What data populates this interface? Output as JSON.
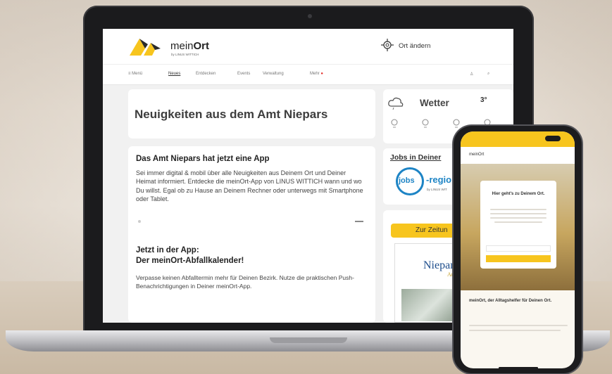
{
  "brand": {
    "name_pre": "mein",
    "name_bold": "Ort",
    "byline": "by LINUS WITTICH"
  },
  "header": {
    "location_label": "Ort ändern"
  },
  "nav": {
    "items": [
      "Menü",
      "Neues",
      "Entdecken",
      "Events",
      "Verwaltung",
      "Mehr"
    ]
  },
  "main": {
    "news_heading": "Neuigkeiten aus dem Amt Niepars",
    "app_card": {
      "title": "Das Amt Niepars hat jetzt eine App",
      "body": "Sei immer digital & mobil über alle Neuigkeiten aus Deinem Ort und Deiner Heimat informiert. Entdecke die meinOrt-App von LINUS WITTICH wann und wo Du willst. Egal ob zu Hause an Deinem Rechner oder unterwegs mit Smartphone oder Tablet."
    },
    "calendar_card": {
      "title_line1": "Jetzt in der App:",
      "title_line2": "Der meinOrt-Abfallkalender!",
      "body": "Verpasse keinen Abfalltermin mehr für Deinen Bezirk. Nutze die praktischen Push-Benachrichtigungen in Deiner meinOrt-App."
    }
  },
  "sidebar": {
    "weather_label": "Wetter",
    "weather_temp": "3°",
    "jobs_title": "Jobs in Deiner",
    "jobs_logo_prefix": "jobs",
    "jobs_logo_suffix": "-region",
    "jobs_logo_byline": "by LINUS WIT",
    "newspaper_button": "Zur Zeitun",
    "newspaper_name": "Niepar",
    "newspaper_sub": "Amt"
  },
  "phone": {
    "logo": "meinOrt",
    "card_title": "Hier geht's zu Deinem Ort.",
    "bottom_text": "meinOrt, der Alltagshelfer für Deinen Ort."
  },
  "colors": {
    "accent": "#f7c51e",
    "link_blue": "#1d84c5",
    "dark": "#1b1b1d"
  }
}
